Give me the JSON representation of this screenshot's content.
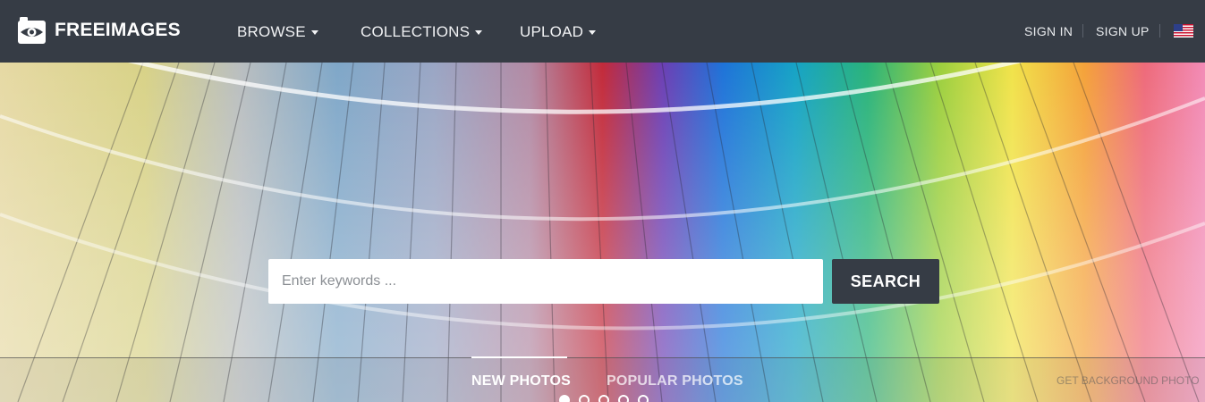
{
  "header": {
    "logo_text": "FREEIMAGES",
    "nav": [
      {
        "label": "BROWSE"
      },
      {
        "label": "COLLECTIONS"
      },
      {
        "label": "UPLOAD"
      }
    ],
    "sign_in": "SIGN IN",
    "sign_up": "SIGN UP",
    "language_flag_icon": "us-flag-icon"
  },
  "hero": {
    "search": {
      "placeholder": "Enter keywords ...",
      "button_label": "SEARCH"
    },
    "slides": {
      "count": 5,
      "active_index": 0
    },
    "tabs": [
      {
        "label": "NEW PHOTOS",
        "active": true
      },
      {
        "label": "POPULAR PHOTOS",
        "active": false
      }
    ],
    "get_background_label": "GET BACKGROUND PHOTO"
  },
  "colors": {
    "header_bg": "#363c45",
    "button_bg": "#363c45",
    "text_white": "#ffffff"
  }
}
